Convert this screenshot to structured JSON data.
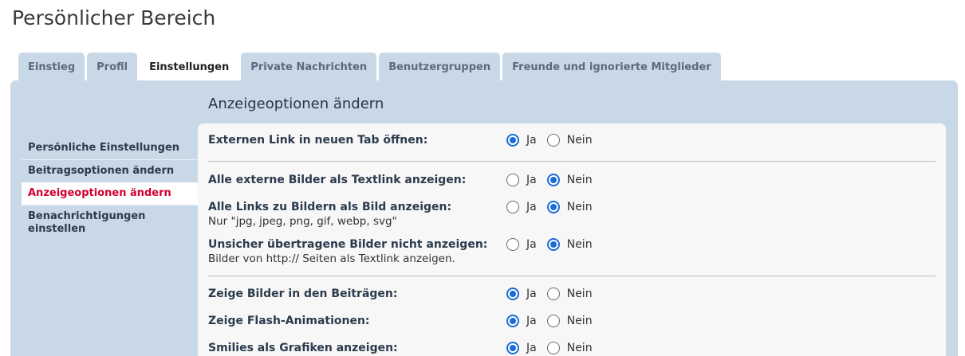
{
  "page_title": "Persönlicher Bereich",
  "tabs": [
    {
      "label": "Einstieg"
    },
    {
      "label": "Profil"
    },
    {
      "label": "Einstellungen"
    },
    {
      "label": "Private Nachrichten"
    },
    {
      "label": "Benutzergruppen"
    },
    {
      "label": "Freunde und ignorierte Mitglieder"
    }
  ],
  "active_tab": "Einstellungen",
  "sidebar": {
    "items": [
      {
        "label": "Persönliche Einstellungen"
      },
      {
        "label": "Beitragsoptionen ändern"
      },
      {
        "label": "Anzeigeoptionen ändern"
      },
      {
        "label": "Benachrichtigungen einstellen"
      }
    ],
    "active": "Anzeigeoptionen ändern"
  },
  "section_title": "Anzeigeoptionen ändern",
  "option_yes": "Ja",
  "option_no": "Nein",
  "settings": [
    {
      "label": "Externen Link in neuen Tab öffnen:",
      "desc": "",
      "value": "Ja"
    },
    {
      "label": "Alle externe Bilder als Textlink anzeigen:",
      "desc": "",
      "value": "Nein"
    },
    {
      "label": "Alle Links zu Bildern als Bild anzeigen:",
      "desc": "Nur \"jpg, jpeg, png, gif, webp, svg\"",
      "value": "Nein"
    },
    {
      "label": "Unsicher übertragene Bilder nicht anzeigen:",
      "desc": "Bilder von http:// Seiten als Textlink anzeigen.",
      "value": "Nein"
    },
    {
      "label": "Zeige Bilder in den Beiträgen:",
      "desc": "",
      "value": "Ja"
    },
    {
      "label": "Zeige Flash-Animationen:",
      "desc": "",
      "value": "Ja"
    },
    {
      "label": "Smilies als Grafiken anzeigen:",
      "desc": "",
      "value": "Ja"
    }
  ],
  "colors": {
    "panel_bg": "#c9d8e6",
    "content_bg": "#f7f7f7",
    "active_side_text": "#d3002e",
    "radio_checked": "#1a6cd6"
  }
}
